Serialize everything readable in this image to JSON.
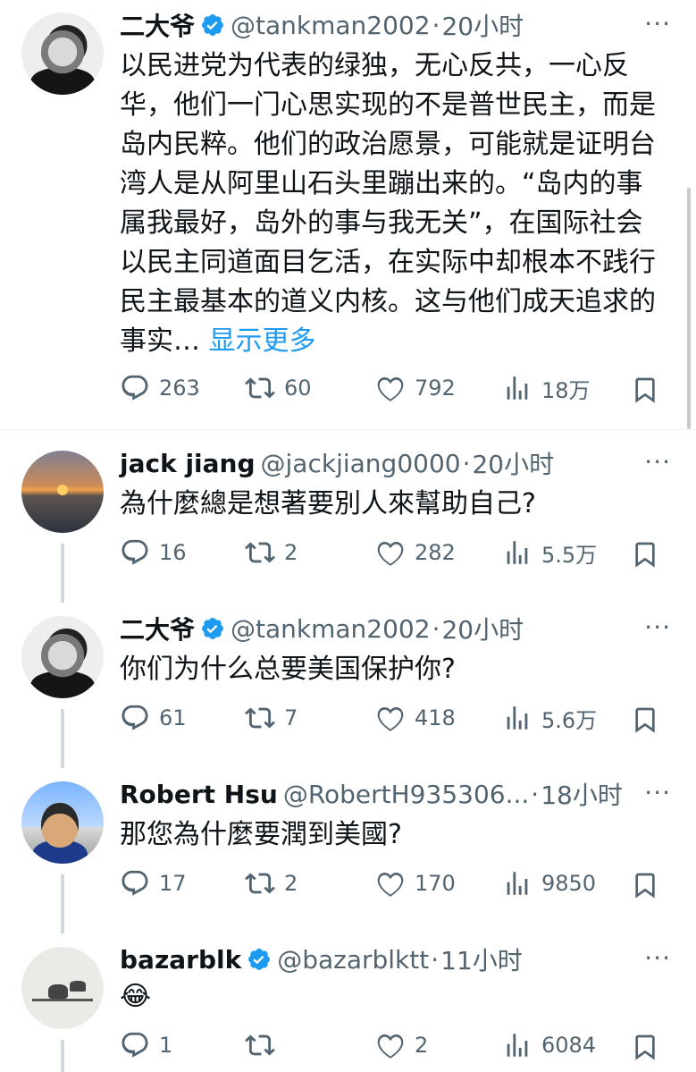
{
  "tweets": [
    {
      "name": "二大爷",
      "handle": "@tankman2002",
      "time": "20小时",
      "verified": true,
      "text": "以民进党为代表的绿独，无心反共，一心反华，他们一门心思实现的不是普世民主，而是岛内民粹。他们的政治愿景，可能就是证明台湾人是从阿里山石头里蹦出来的。“岛内的事属我最好，岛外的事与我无关”，在国际社会以民主同道面目乞活，在实际中却根本不践行民主最基本的道义内核。这与他们成天追求的事实…",
      "show_more": "显示更多",
      "replies": "263",
      "retweets": "60",
      "likes": "792",
      "views": "18万"
    },
    {
      "name": "jack jiang",
      "handle": "@jackjiang0000",
      "time": "20小时",
      "verified": false,
      "text": "為什麼總是想著要別人來幫助自己?",
      "replies": "16",
      "retweets": "2",
      "likes": "282",
      "views": "5.5万"
    },
    {
      "name": "二大爷",
      "handle": "@tankman2002",
      "time": "20小时",
      "verified": true,
      "text": "你们为什么总要美国保护你?",
      "replies": "61",
      "retweets": "7",
      "likes": "418",
      "views": "5.6万"
    },
    {
      "name": "Robert Hsu",
      "handle": "@RobertH935306...",
      "time": "18小时",
      "verified": false,
      "text": "那您為什麼要潤到美國?",
      "replies": "17",
      "retweets": "2",
      "likes": "170",
      "views": "9850"
    },
    {
      "name": "bazarblk",
      "handle": "@bazarblktt",
      "time": "11小时",
      "verified": true,
      "text": "😂",
      "replies": "1",
      "retweets": "",
      "likes": "2",
      "views": "6084"
    }
  ],
  "separator": "·",
  "more_glyph": "···",
  "icons": [
    "reply-icon",
    "retweet-icon",
    "like-icon",
    "views-icon",
    "bookmark-icon",
    "verified-icon",
    "more-icon"
  ],
  "colors": {
    "link": "#1d9bf0",
    "secondary": "#536471",
    "text": "#0f1419",
    "thread_line": "#cfd9de"
  }
}
